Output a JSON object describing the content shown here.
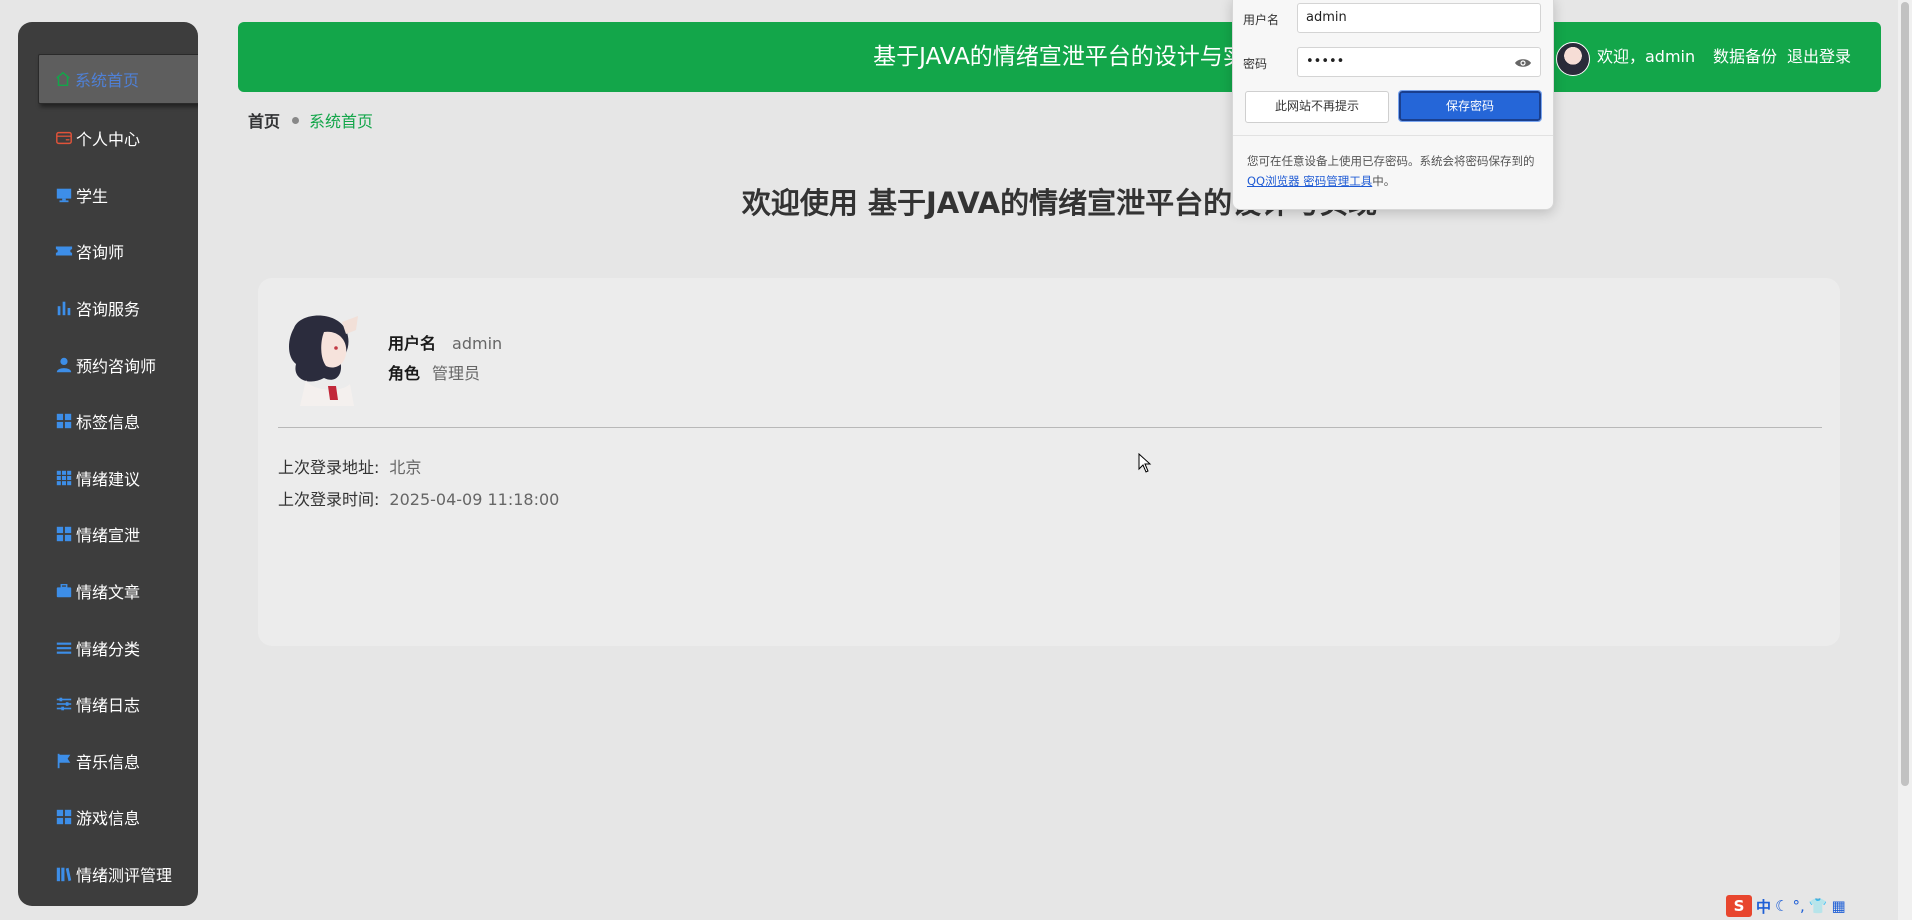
{
  "sidebar": {
    "items": [
      {
        "label": "系统首页",
        "icon": "home-icon",
        "active": true
      },
      {
        "label": "个人中心",
        "icon": "card-icon"
      },
      {
        "label": "学生",
        "icon": "monitor-icon"
      },
      {
        "label": "咨询师",
        "icon": "ticket-icon"
      },
      {
        "label": "咨询服务",
        "icon": "bar-chart-icon"
      },
      {
        "label": "预约咨询师",
        "icon": "user-icon"
      },
      {
        "label": "标签信息",
        "icon": "grid-icon"
      },
      {
        "label": "情绪建议",
        "icon": "grid-9-icon"
      },
      {
        "label": "情绪宣泄",
        "icon": "grid-icon"
      },
      {
        "label": "情绪文章",
        "icon": "briefcase-icon"
      },
      {
        "label": "情绪分类",
        "icon": "list-icon"
      },
      {
        "label": "情绪日志",
        "icon": "sliders-icon"
      },
      {
        "label": "音乐信息",
        "icon": "flag-icon"
      },
      {
        "label": "游戏信息",
        "icon": "grid-icon"
      },
      {
        "label": "情绪测评管理",
        "icon": "books-icon"
      }
    ]
  },
  "header": {
    "title": "基于JAVA的情绪宣泄平台的设计与实",
    "welcome": "欢迎，admin",
    "backup": "数据备份",
    "logout": "退出登录"
  },
  "breadcrumb": {
    "home": "首页",
    "current": "系统首页"
  },
  "main": {
    "title": "欢迎使用 基于JAVA的情绪宣泄平台的设计与实现",
    "profile": {
      "username_label": "用户名",
      "username": "admin",
      "role_label": "角色",
      "role": "管理员",
      "last_login_addr_label": "上次登录地址:",
      "last_login_addr": "北京",
      "last_login_time_label": "上次登录时间:",
      "last_login_time": "2025-04-09 11:18:00"
    }
  },
  "password_popup": {
    "username_label": "用户名",
    "username_value": "admin",
    "password_label": "密码",
    "password_value": "•••••",
    "never_button": "此网站不再提示",
    "save_button": "保存密码",
    "note_prefix": "您可在任意设备上使用已存密码。系统会将密码保存到的",
    "note_link": "QQ浏览器 密码管理工具",
    "note_suffix": "中。"
  },
  "ime": {
    "zh": "中"
  },
  "colors": {
    "accent_green": "#13a64a",
    "sidebar_bg": "#3d3d3d",
    "icon_blue": "#3d8ee8",
    "save_blue": "#2566d8"
  }
}
